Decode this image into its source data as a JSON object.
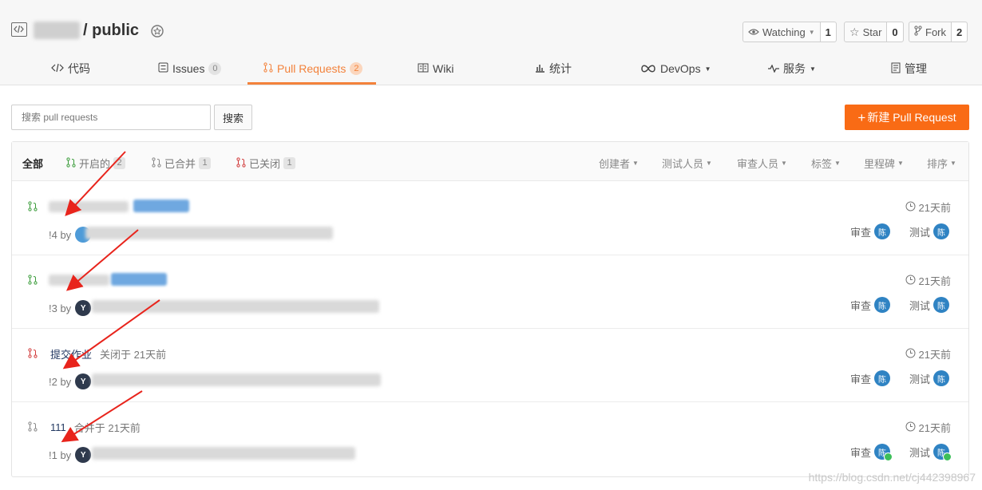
{
  "repo": {
    "separator": "/",
    "name": "public"
  },
  "header_buttons": {
    "watching": {
      "label": "Watching",
      "count": "1"
    },
    "star": {
      "label": "Star",
      "count": "0"
    },
    "fork": {
      "label": "Fork",
      "count": "2"
    }
  },
  "tabs": [
    {
      "label": "代码",
      "icon": "code-icon"
    },
    {
      "label": "Issues",
      "count": "0",
      "icon": "issues-icon"
    },
    {
      "label": "Pull Requests",
      "count": "2",
      "icon": "pull-request-icon",
      "active": true
    },
    {
      "label": "Wiki",
      "icon": "book-icon"
    },
    {
      "label": "统计",
      "icon": "bar-chart-icon"
    },
    {
      "label": "DevOps",
      "icon": "infinity-icon"
    },
    {
      "label": "服务",
      "icon": "pulse-icon"
    },
    {
      "label": "管理",
      "icon": "settings-doc-icon"
    }
  ],
  "toolbar": {
    "search_placeholder": "搜索 pull requests",
    "search_button": "搜索",
    "new_pr": "新建 Pull Request"
  },
  "filters": [
    {
      "label": "全部"
    },
    {
      "label": "开启的",
      "count": "2"
    },
    {
      "label": "已合并",
      "count": "1"
    },
    {
      "label": "已关闭",
      "count": "1"
    }
  ],
  "sorters": [
    "创建者",
    "测试人员",
    "审查人员",
    "标签",
    "里程碑",
    "排序"
  ],
  "pull_requests": [
    {
      "state": "open",
      "title": "",
      "status": "",
      "number": "!4 by",
      "time": "21天前",
      "review": "审查",
      "test": "测试",
      "avatar": "陈"
    },
    {
      "state": "open",
      "title": "",
      "status": "",
      "number": "!3 by",
      "time": "21天前",
      "review": "审查",
      "test": "测试",
      "avatar": "陈"
    },
    {
      "state": "closed",
      "title": "提交作业",
      "status": "关闭于 21天前",
      "number": "!2 by",
      "time": "21天前",
      "review": "审查",
      "test": "测试",
      "avatar": "陈"
    },
    {
      "state": "merged",
      "title": "111",
      "status": "合并于 21天前",
      "number": "!1 by",
      "time": "21天前",
      "review": "审查",
      "test": "测试",
      "avatar": "陈"
    }
  ],
  "author_avatar": "Y",
  "watermark": "https://blog.csdn.net/cj442398967",
  "colors": {
    "accent": "#f3823b",
    "primary_button": "#f96b15",
    "open": "#3c9d3c",
    "closed": "#d23b3b",
    "merged": "#888888"
  }
}
